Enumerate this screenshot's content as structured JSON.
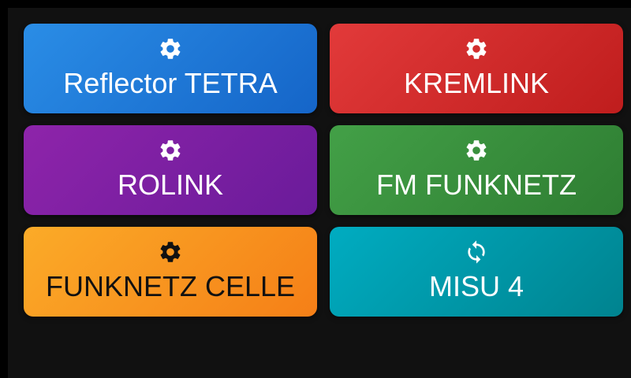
{
  "tiles": [
    {
      "label": "Reflector TETRA",
      "icon": "gear-icon",
      "color": "#1e78d8"
    },
    {
      "label": "KREMLINK",
      "icon": "gear-icon",
      "color": "#d32f2f"
    },
    {
      "label": "ROLINK",
      "icon": "gear-icon",
      "color": "#7b1fa2"
    },
    {
      "label": "FM FUNKNETZ",
      "icon": "gear-icon",
      "color": "#388e3c"
    },
    {
      "label": "FUNKNETZ CELLE",
      "icon": "gear-icon",
      "color": "#f9a825"
    },
    {
      "label": "MISU 4",
      "icon": "sync-icon",
      "color": "#0097a7"
    }
  ]
}
